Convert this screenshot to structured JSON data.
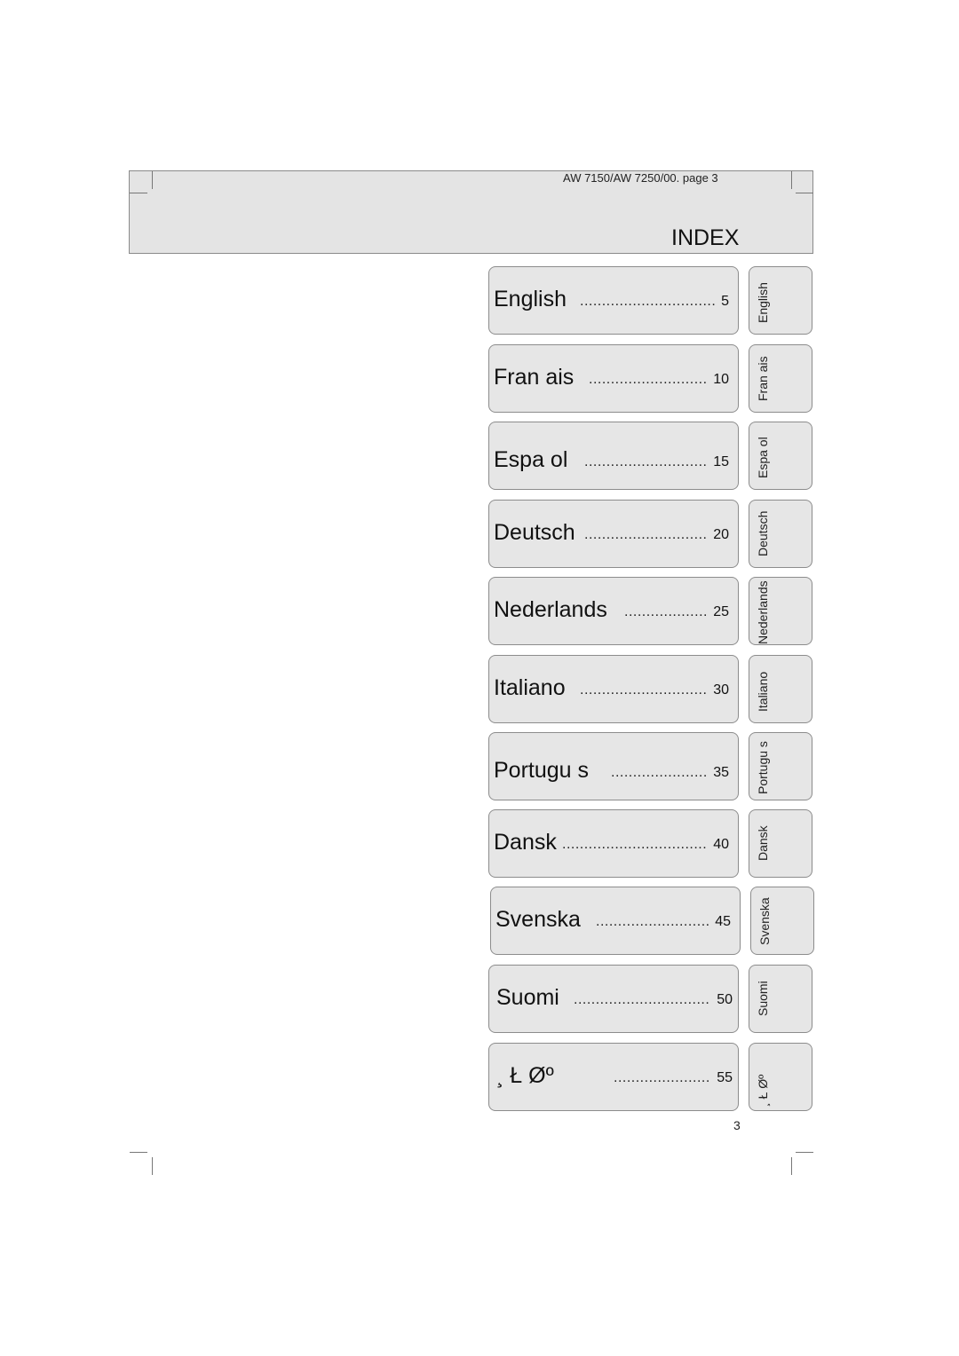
{
  "header": {
    "document_ref": "AW 7150/AW 7250/00. page 3",
    "title": "INDEX"
  },
  "entries": [
    {
      "label": "English",
      "dots": "...............................",
      "page": "5",
      "tab": "English"
    },
    {
      "label": "Fran ais",
      "dots": "...........................",
      "page": "10",
      "tab": "Fran ais"
    },
    {
      "label": "Espa ol",
      "dots": "............................",
      "page": "15",
      "tab": "Espa ol"
    },
    {
      "label": "Deutsch",
      "dots": "............................",
      "page": "20",
      "tab": "Deutsch"
    },
    {
      "label": "Nederlands",
      "dots": "...................",
      "page": "25",
      "tab": "Nederlands"
    },
    {
      "label": "Italiano",
      "dots": ".............................",
      "page": "30",
      "tab": "Italiano"
    },
    {
      "label": "Portugu s",
      "dots": "......................",
      "page": "35",
      "tab": "Portugu s"
    },
    {
      "label": "Dansk",
      "dots": ".................................",
      "page": "40",
      "tab": "Dansk"
    },
    {
      "label": "Svenska",
      "dots": "..........................",
      "page": "45",
      "tab": "Svenska"
    },
    {
      "label": "Suomi",
      "dots": "...............................",
      "page": "50",
      "tab": "Suomi"
    },
    {
      "label": "¸  Ł Øº",
      "dots": "......................",
      "page": "55",
      "tab": "¸ Ł Øº"
    }
  ],
  "footer": {
    "page_number": "3"
  }
}
